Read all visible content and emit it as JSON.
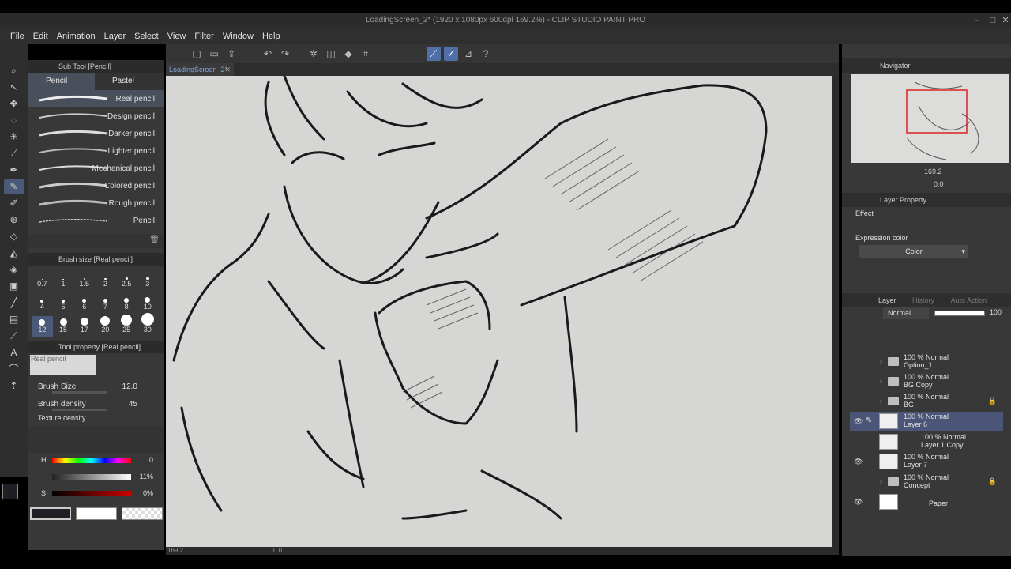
{
  "window": {
    "title": "LoadingScreen_2* (1920 x 1080px 600dpi 169.2%) - CLIP STUDIO PAINT PRO"
  },
  "menu": [
    "File",
    "Edit",
    "Animation",
    "Layer",
    "Select",
    "View",
    "Filter",
    "Window",
    "Help"
  ],
  "document_tab": "LoadingScreen_2*",
  "sub_tool": {
    "header": "Sub Tool [Pencil]",
    "tabs": [
      "Pencil",
      "Pastel"
    ],
    "brushes": [
      "Real pencil",
      "Design pencil",
      "Darker pencil",
      "Lighter pencil",
      "Mechanical pencil",
      "Colored pencil",
      "Rough pencil",
      "Pencil"
    ]
  },
  "brush_size": {
    "header": "Brush size [Real pencil]",
    "sizes": [
      "0.7",
      "1",
      "1.5",
      "2",
      "2.5",
      "3",
      "4",
      "5",
      "6",
      "7",
      "8",
      "10",
      "12",
      "15",
      "17",
      "20",
      "25",
      "30"
    ],
    "selected": "12"
  },
  "tool_property": {
    "header": "Tool property [Real pencil]",
    "preview_label": "Real pencil",
    "brush_size_label": "Brush Size",
    "brush_size_value": "12.0",
    "brush_density_label": "Brush density",
    "brush_density_value": "45",
    "texture_density_label": "Texture density"
  },
  "color": {
    "h_label": "H",
    "h_value": "0",
    "s_value": "11%",
    "v_label": "S",
    "v_value": "0%",
    "main_color": "#1e1f24",
    "sub_color": "#ffffff"
  },
  "navigator": {
    "title": "Navigator",
    "zoom": "169.2",
    "angle": "0.0"
  },
  "layer_property": {
    "title": "Layer Property",
    "effect_label": "Effect",
    "expression_label": "Expression color",
    "expression_value": "Color"
  },
  "layer_panel": {
    "tabs": [
      "Layer",
      "History",
      "Auto Action"
    ],
    "blend_mode": "Normal",
    "opacity": "100",
    "layers": [
      {
        "mode": "100 % Normal",
        "name": "Option_1"
      },
      {
        "mode": "100 % Normal",
        "name": "BG Copy"
      },
      {
        "mode": "100 % Normal",
        "name": "BG"
      },
      {
        "mode": "100 % Normal",
        "name": "Layer 6"
      },
      {
        "mode": "100 % Normal",
        "name": "Layer 1 Copy"
      },
      {
        "mode": "100 % Normal",
        "name": "Layer 7"
      },
      {
        "mode": "100 % Normal",
        "name": "Concept"
      },
      {
        "mode": "",
        "name": "Paper"
      }
    ]
  },
  "status": {
    "zoom": "169.2",
    "angle": "0.0"
  },
  "accent": "#4a5578"
}
